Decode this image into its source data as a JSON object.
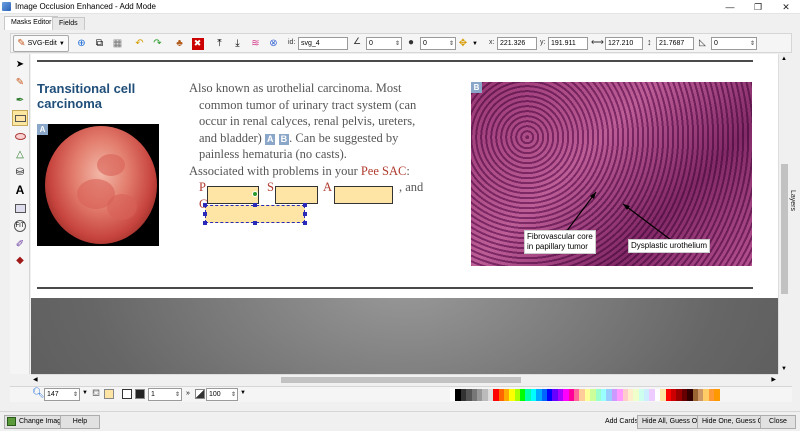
{
  "window": {
    "title": "Image Occlusion Enhanced - Add Mode",
    "min": "—",
    "max": "❐",
    "close": "✕"
  },
  "tabs": [
    {
      "label": "Masks Editor"
    },
    {
      "label": "Fields"
    }
  ],
  "toolbar": {
    "svg_edit_label": "SVG-Edit",
    "id_label": "id:",
    "id_value": "svg_4",
    "rotate_value": "0",
    "blur_value": "0",
    "opacity_value": "0",
    "x_label": "x:",
    "x_value": "221.326",
    "y_label": "y:",
    "y_value": "191.911",
    "w_value": "127.210",
    "h_value": "21.7687",
    "radius_value": "0"
  },
  "document": {
    "heading": "Transitional cell carcinoma",
    "image_a_badge": "A",
    "image_b_badge": "B",
    "lines": [
      "Also known as urothelial carcinoma. Most",
      "common tumor of urinary tract system (can",
      "occur in renal calyces, renal pelvis, ureters,",
      "and bladder)",
      ". Can be suggested by",
      "painless hematuria (no casts).",
      "Associated with problems in your ",
      "Pee SAC",
      ":",
      ", and"
    ],
    "inline_badge_a": "A",
    "inline_badge_b": "B",
    "mask_letters": {
      "p": "P",
      "s": "S",
      "a": "A",
      "c": "C"
    },
    "callout_1": "Fibrovascular core\nin papillary tumor",
    "callout_2": "Dysplastic urothelium"
  },
  "bottom": {
    "zoom_value": "147",
    "stroke_width_value": "1",
    "opacity_value": "100",
    "arrow": "»"
  },
  "layers_label": "Layers",
  "status": {
    "change_image": "Change Image",
    "help": "Help",
    "add_cards": "Add Cards:",
    "hide_all": "Hide All, Guess One",
    "hide_one": "Hide One, Guess One",
    "close": "Close"
  },
  "palette": [
    "#ffffff",
    "#000000",
    "#333333",
    "#555555",
    "#777777",
    "#999999",
    "#bbbbbb",
    "#dddddd",
    "#ff0000",
    "#ff6600",
    "#ffaa00",
    "#ffff00",
    "#aaff00",
    "#00ff00",
    "#00ffaa",
    "#00ffff",
    "#00aaff",
    "#0066ff",
    "#0000ff",
    "#6600ff",
    "#aa00ff",
    "#ff00ff",
    "#ff0099",
    "#ff6699",
    "#ffcc99",
    "#ffff99",
    "#ccff99",
    "#99ffcc",
    "#99ffff",
    "#99ccff",
    "#cc99ff",
    "#ff99ff",
    "#ffcccc",
    "#ffeecc",
    "#eeffcc",
    "#ccffee",
    "#cceeff",
    "#eeccff",
    "#ffffff",
    "#ffe5a5",
    "#ff0000",
    "#cc0000",
    "#990000",
    "#660000",
    "#330000",
    "#996633",
    "#cc9966",
    "#ffcc66",
    "#ff9933",
    "#ff9900"
  ]
}
